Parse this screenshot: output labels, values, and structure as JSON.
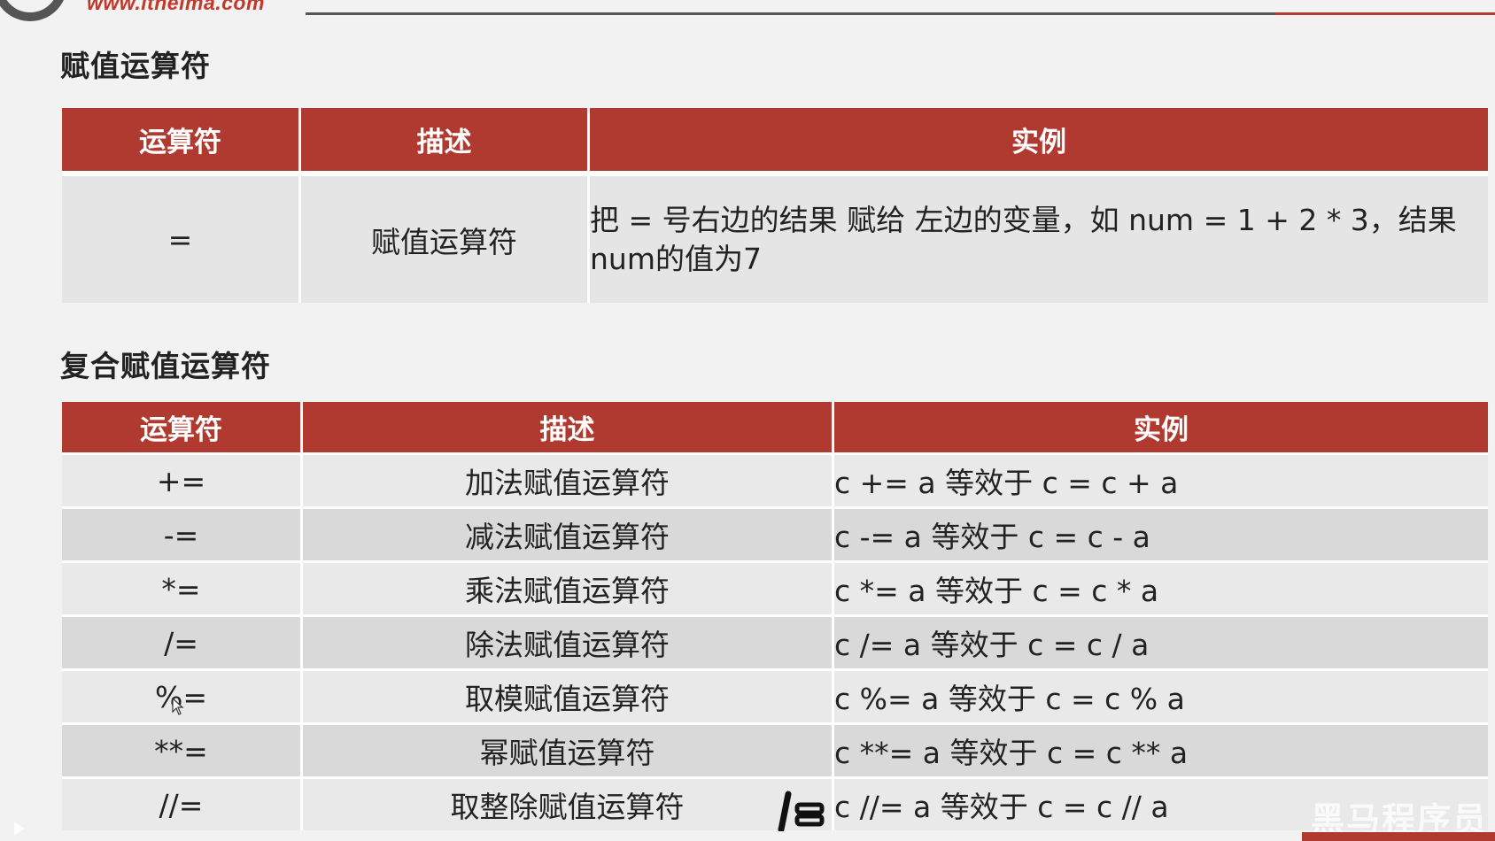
{
  "header": {
    "site_url": "www.itheima.com"
  },
  "section_assign": {
    "title": "赋值运算符",
    "columns": [
      "运算符",
      "描述",
      "实例"
    ],
    "rows": [
      {
        "op": "=",
        "desc": "赋值运算符",
        "example": "把 = 号右边的结果 赋给 左边的变量，如 num = 1 + 2 * 3，结果num的值为7"
      }
    ]
  },
  "section_compound": {
    "title": "复合赋值运算符",
    "columns": [
      "运算符",
      "描述",
      "实例"
    ],
    "rows": [
      {
        "op": "+=",
        "desc": "加法赋值运算符",
        "example": "c += a 等效于 c = c + a"
      },
      {
        "op": "-=",
        "desc": "减法赋值运算符",
        "example": "c -= a 等效于 c = c - a"
      },
      {
        "op": "*=",
        "desc": "乘法赋值运算符",
        "example": "c *= a 等效于 c = c * a"
      },
      {
        "op": "/=",
        "desc": "除法赋值运算符",
        "example": "c /= a 等效于 c = c / a"
      },
      {
        "op": "%=",
        "desc": "取模赋值运算符",
        "example": "c %= a 等效于 c = c % a"
      },
      {
        "op": "**=",
        "desc": "幂赋值运算符",
        "example": "c **= a 等效于 c = c ** a"
      },
      {
        "op": "//=",
        "desc": "取整除赋值运算符",
        "example": "c //= a 等效于 c = c // a"
      }
    ]
  },
  "watermark": {
    "text": "黑马程序员"
  },
  "colors": {
    "header_red": "#b03a2f",
    "brand_red": "#c0392b",
    "row_light": "#e9e9e9",
    "row_dark": "#d9d9d9"
  },
  "icons": [
    "logo-ring-icon",
    "cursor-icon",
    "pen-tool-icon",
    "play-icon"
  ]
}
